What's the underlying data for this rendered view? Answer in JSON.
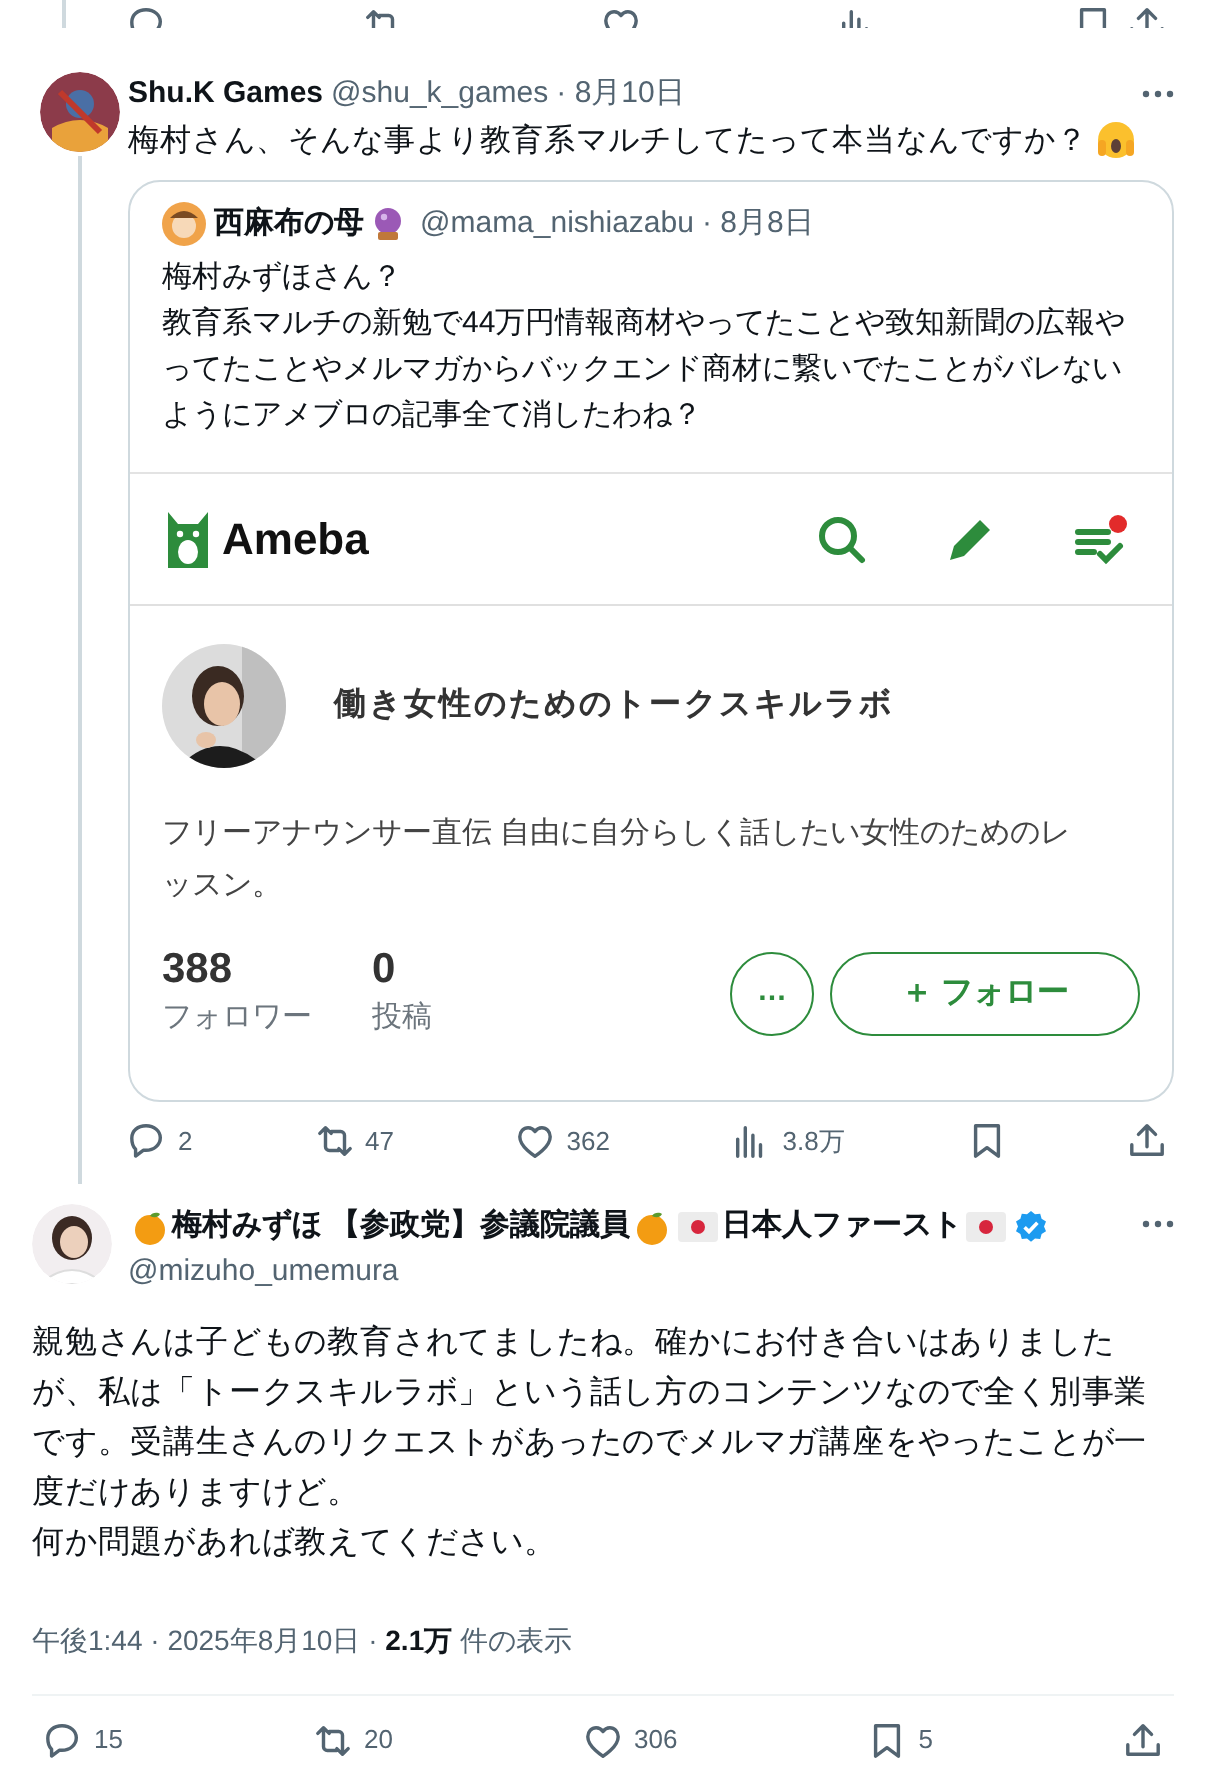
{
  "reply": {
    "name": "Shu.K Games",
    "handle": "@shu_k_games",
    "date": "· 8月10日",
    "text": "梅村さん、そんな事より教育系マルチしてたって本当なんですか？",
    "quote": {
      "name": "西麻布の母",
      "handle": "@mama_nishiazabu",
      "date": "· 8月8日",
      "paragraphs": [
        "梅村みずほさん？",
        "教育系マルチの新勉で44万円情報商材やってたことや致知新聞の広報やってたことやメルマガからバックエンド商材に繋いでたことがバレないようにアメブロの記事全て消したわね？"
      ],
      "embed": {
        "logo": "Ameba",
        "notification": true,
        "blog_title": "働き女性のためのトークスキルラボ",
        "description": "フリーアナウンサー直伝 自由に自分らしく話したい女性のためのレッスン。",
        "stats": [
          {
            "value": "388",
            "label": "フォロワー"
          },
          {
            "value": "0",
            "label": "投稿"
          }
        ],
        "more": "…",
        "follow": "＋ フォロー"
      }
    },
    "actions": [
      {
        "kind": "reply",
        "count": "2"
      },
      {
        "kind": "repost",
        "count": "47"
      },
      {
        "kind": "like",
        "count": "362"
      },
      {
        "kind": "views",
        "count": "3.8万"
      },
      {
        "kind": "bookmark"
      },
      {
        "kind": "share"
      }
    ]
  },
  "main": {
    "name_parts": [
      {
        "kind": "orange"
      },
      {
        "kind": "text",
        "text": "梅村みずほ 【参政党】参議院議員"
      },
      {
        "kind": "orange"
      },
      {
        "kind": "flag"
      },
      {
        "kind": "text",
        "text": "日本人ファースト"
      },
      {
        "kind": "flag"
      },
      {
        "kind": "verified"
      }
    ],
    "handle": "@mizuho_umemura",
    "paragraphs": [
      "親勉さんは子どもの教育されてましたね。確かにお付き合いはありましたが、私は「トークスキルラボ」という話し方のコンテンツなので全く別事業です。受講生さんのリクエストがあったのでメルマガ講座をやったことが一度だけありますけど。",
      "何か問題があれば教えてください。"
    ],
    "meta": "午後1:44 · 2025年8月10日 · **2.1万** 件の表示",
    "actions": [
      {
        "kind": "reply",
        "count": "15"
      },
      {
        "kind": "repost",
        "count": "20"
      },
      {
        "kind": "like",
        "count": "306"
      },
      {
        "kind": "bookmark",
        "count": "5"
      },
      {
        "kind": "share"
      }
    ]
  }
}
